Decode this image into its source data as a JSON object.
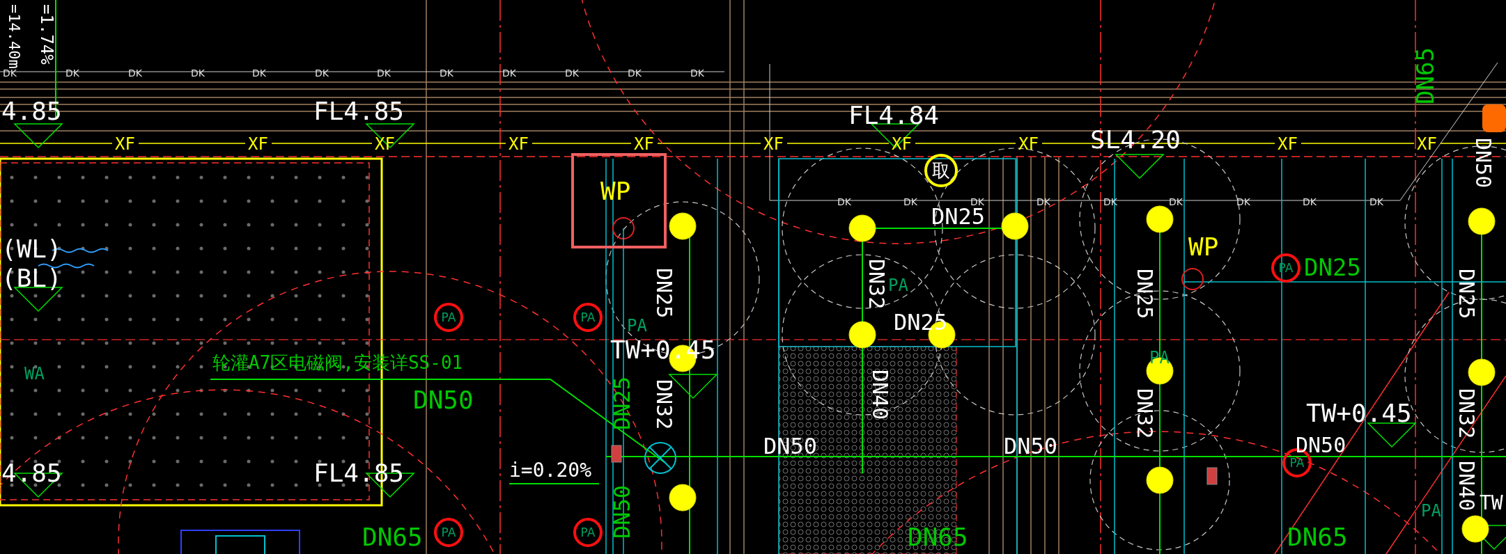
{
  "labels": [
    {
      "text": "=14.40m",
      "kind": "text",
      "color": "#ffffff"
    },
    {
      "text": "=1.74%",
      "kind": "text",
      "color": "#ffffff"
    },
    {
      "text": "4.85",
      "kind": "text",
      "color": "#ffffff"
    },
    {
      "text": "FL4.85",
      "kind": "text",
      "color": "#ffffff"
    },
    {
      "text": "WP",
      "kind": "boxed",
      "color": "#ffff00"
    },
    {
      "text": "FL4.84",
      "kind": "text",
      "color": "#ffffff"
    },
    {
      "text": "SL4.20",
      "kind": "text",
      "color": "#ffffff"
    },
    {
      "text": "取",
      "kind": "circled",
      "color": "#ffff00"
    },
    {
      "text": "DN25",
      "kind": "text",
      "color": "#ffffff"
    },
    {
      "text": "WP",
      "kind": "text",
      "color": "#ffff00"
    },
    {
      "text": "DN65",
      "kind": "text",
      "color": "#00c800"
    },
    {
      "text": "DN50",
      "kind": "text",
      "color": "#ffffff"
    },
    {
      "text": "(WL)",
      "kind": "text",
      "color": "#ffffff"
    },
    {
      "text": "(BL)",
      "kind": "text",
      "color": "#ffffff"
    },
    {
      "text": "WA",
      "kind": "text",
      "color": "#00a060"
    },
    {
      "text": "轮灌A7区电磁阀,安装详SS-01",
      "kind": "text",
      "color": "#00c800"
    },
    {
      "text": "DN50",
      "kind": "text",
      "color": "#00c800"
    },
    {
      "text": "DN25",
      "kind": "text",
      "color": "#ffffff"
    },
    {
      "text": "PA",
      "kind": "text",
      "color": "#00a060"
    },
    {
      "text": "TW+0.45",
      "kind": "text",
      "color": "#ffffff"
    },
    {
      "text": "DN25",
      "kind": "text",
      "color": "#00c800"
    },
    {
      "text": "DN32",
      "kind": "text",
      "color": "#ffffff"
    },
    {
      "text": "4.85",
      "kind": "text",
      "color": "#ffffff"
    },
    {
      "text": "FL4.85",
      "kind": "text",
      "color": "#ffffff"
    },
    {
      "text": "i=0.20%",
      "kind": "text",
      "color": "#ffffff"
    },
    {
      "text": "DN50",
      "kind": "text",
      "color": "#00c800"
    },
    {
      "text": "DN65",
      "kind": "text",
      "color": "#00c800"
    },
    {
      "text": "DN32",
      "kind": "text",
      "color": "#ffffff"
    },
    {
      "text": "PA",
      "kind": "text",
      "color": "#00a060"
    },
    {
      "text": "DN25",
      "kind": "text",
      "color": "#ffffff"
    },
    {
      "text": "DN40",
      "kind": "text",
      "color": "#ffffff"
    },
    {
      "text": "DN50",
      "kind": "text",
      "color": "#ffffff"
    },
    {
      "text": "DN50",
      "kind": "text",
      "color": "#ffffff"
    },
    {
      "text": "DN65",
      "kind": "text",
      "color": "#00c800"
    },
    {
      "text": "DN25",
      "kind": "text",
      "color": "#ffffff"
    },
    {
      "text": "DN25",
      "kind": "text",
      "color": "#00c800"
    },
    {
      "text": "PA",
      "kind": "text",
      "color": "#00a060"
    },
    {
      "text": "DN32",
      "kind": "text",
      "color": "#ffffff"
    },
    {
      "text": "TW+0.45",
      "kind": "text",
      "color": "#ffffff"
    },
    {
      "text": "DN50",
      "kind": "text",
      "color": "#ffffff"
    },
    {
      "text": "DN65",
      "kind": "text",
      "color": "#00c800"
    },
    {
      "text": "DN25",
      "kind": "text",
      "color": "#ffffff"
    },
    {
      "text": "DN32",
      "kind": "text",
      "color": "#ffffff"
    },
    {
      "text": "DN40",
      "kind": "text",
      "color": "#ffffff"
    },
    {
      "text": "PA",
      "kind": "text",
      "color": "#00a060"
    },
    {
      "text": "TW",
      "kind": "text",
      "color": "#ffffff"
    }
  ],
  "pa_markers": [
    "PA",
    "PA",
    "PA",
    "PA",
    "PA",
    "PA"
  ],
  "xf_tags": [
    "XF",
    "XF",
    "XF",
    "XF",
    "XF",
    "XF",
    "XF",
    "XF",
    "XF",
    "XF"
  ],
  "dk_tags": [
    "DK",
    "DK",
    "DK",
    "DK",
    "DK",
    "DK",
    "DK",
    "DK",
    "DK",
    "DK",
    "DK",
    "DK",
    "DK",
    "DK",
    "DK",
    "DK",
    "DK",
    "DK",
    "DK",
    "DK",
    "DK"
  ]
}
